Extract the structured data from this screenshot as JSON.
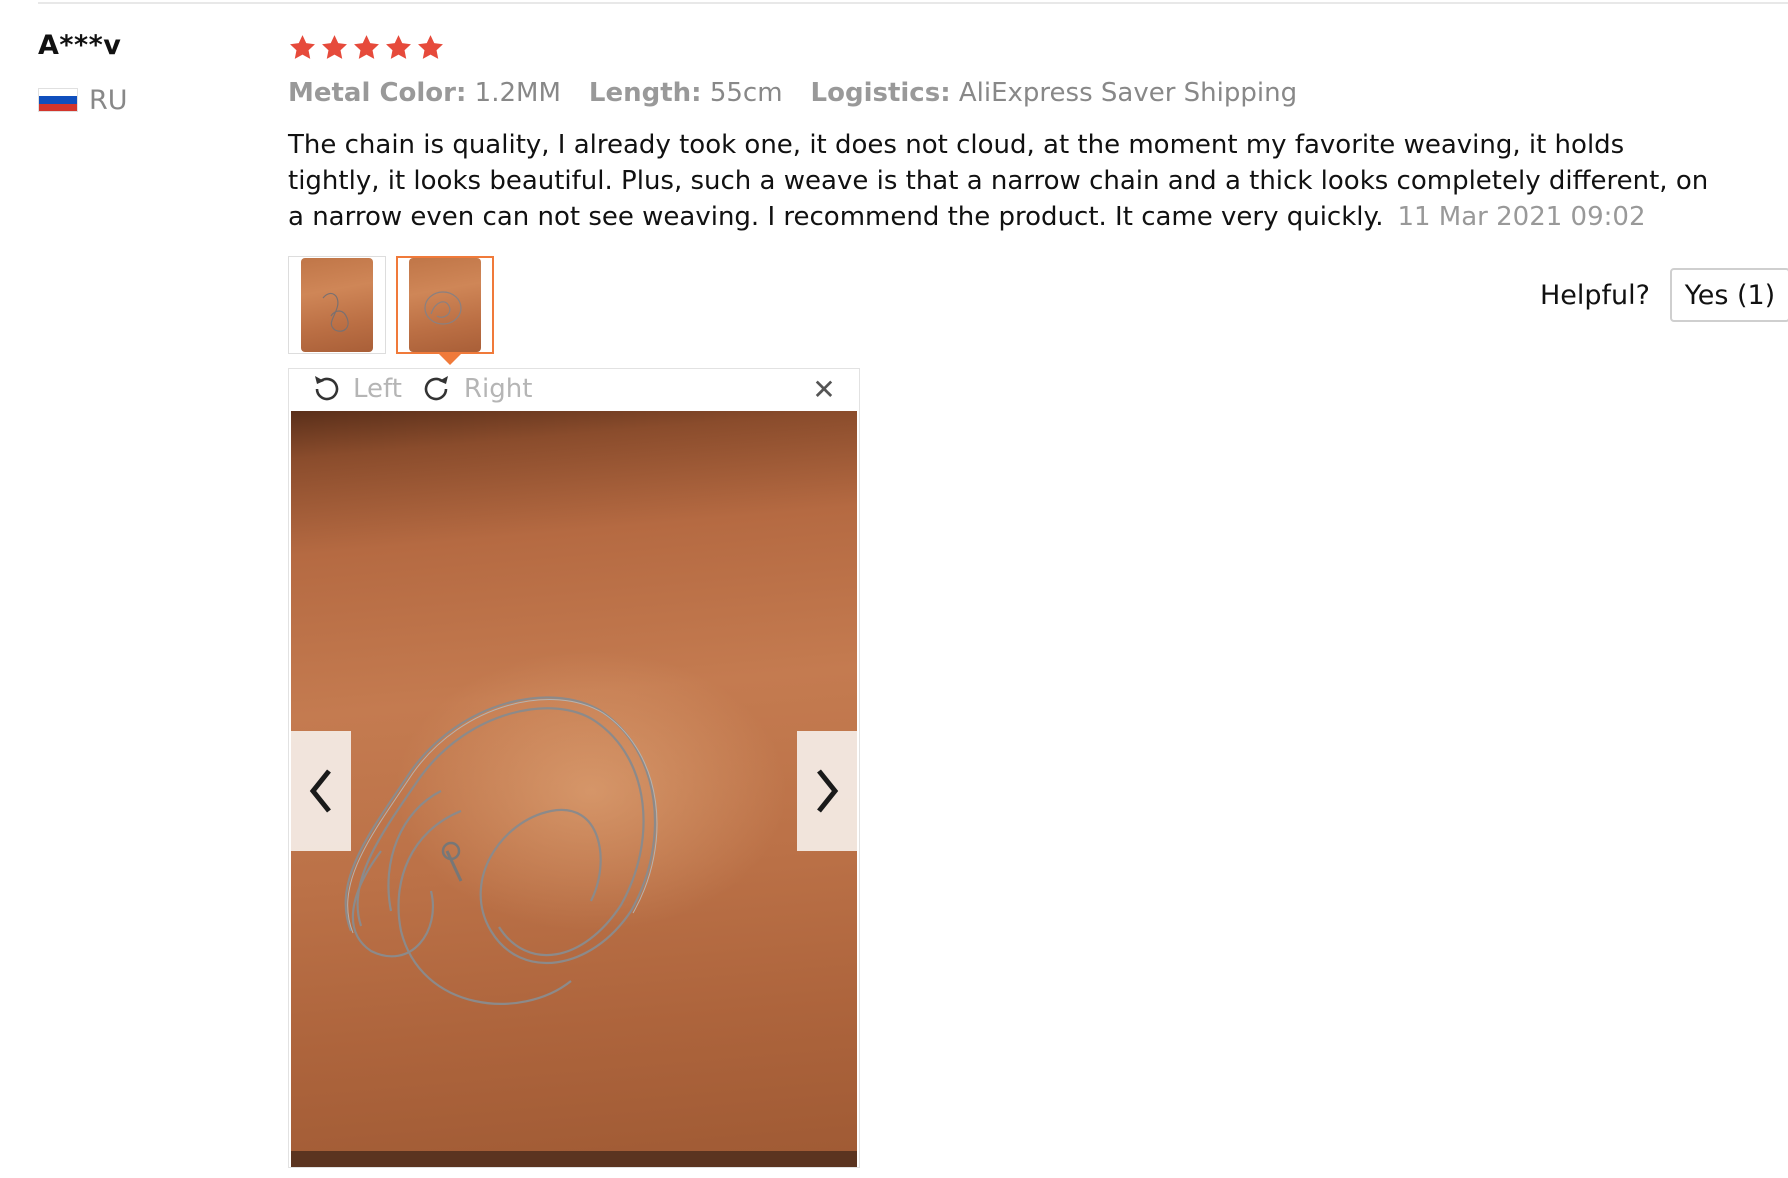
{
  "reviewer": {
    "name": "A***v",
    "country_code": "RU",
    "flag_icon": "russia-flag-icon"
  },
  "review": {
    "rating": 5,
    "star_color": "#e64a3b",
    "attributes": [
      {
        "key": "Metal Color:",
        "value": "1.2MM"
      },
      {
        "key": "Length:",
        "value": "55cm"
      },
      {
        "key": "Logistics:",
        "value": "AliExpress Saver Shipping"
      }
    ],
    "text": "The chain is quality, I already took one, it does not cloud, at the moment my favorite weaving, it holds tightly, it looks beautiful. Plus, such a weave is that a narrow chain and a thick looks completely different, on a narrow even can not see weaving. I recommend the product. It came very quickly.",
    "date": "11 Mar 2021 09:02"
  },
  "thumbnails": {
    "count": 2,
    "active_index": 1,
    "accent_color": "#f07a3a"
  },
  "helpful": {
    "label": "Helpful?",
    "yes_label": "Yes (1)"
  },
  "viewer": {
    "rotate_left_label": "Left",
    "rotate_right_label": "Right",
    "close_icon": "close-icon",
    "prev_icon": "chevron-left-icon",
    "next_icon": "chevron-right-icon"
  }
}
